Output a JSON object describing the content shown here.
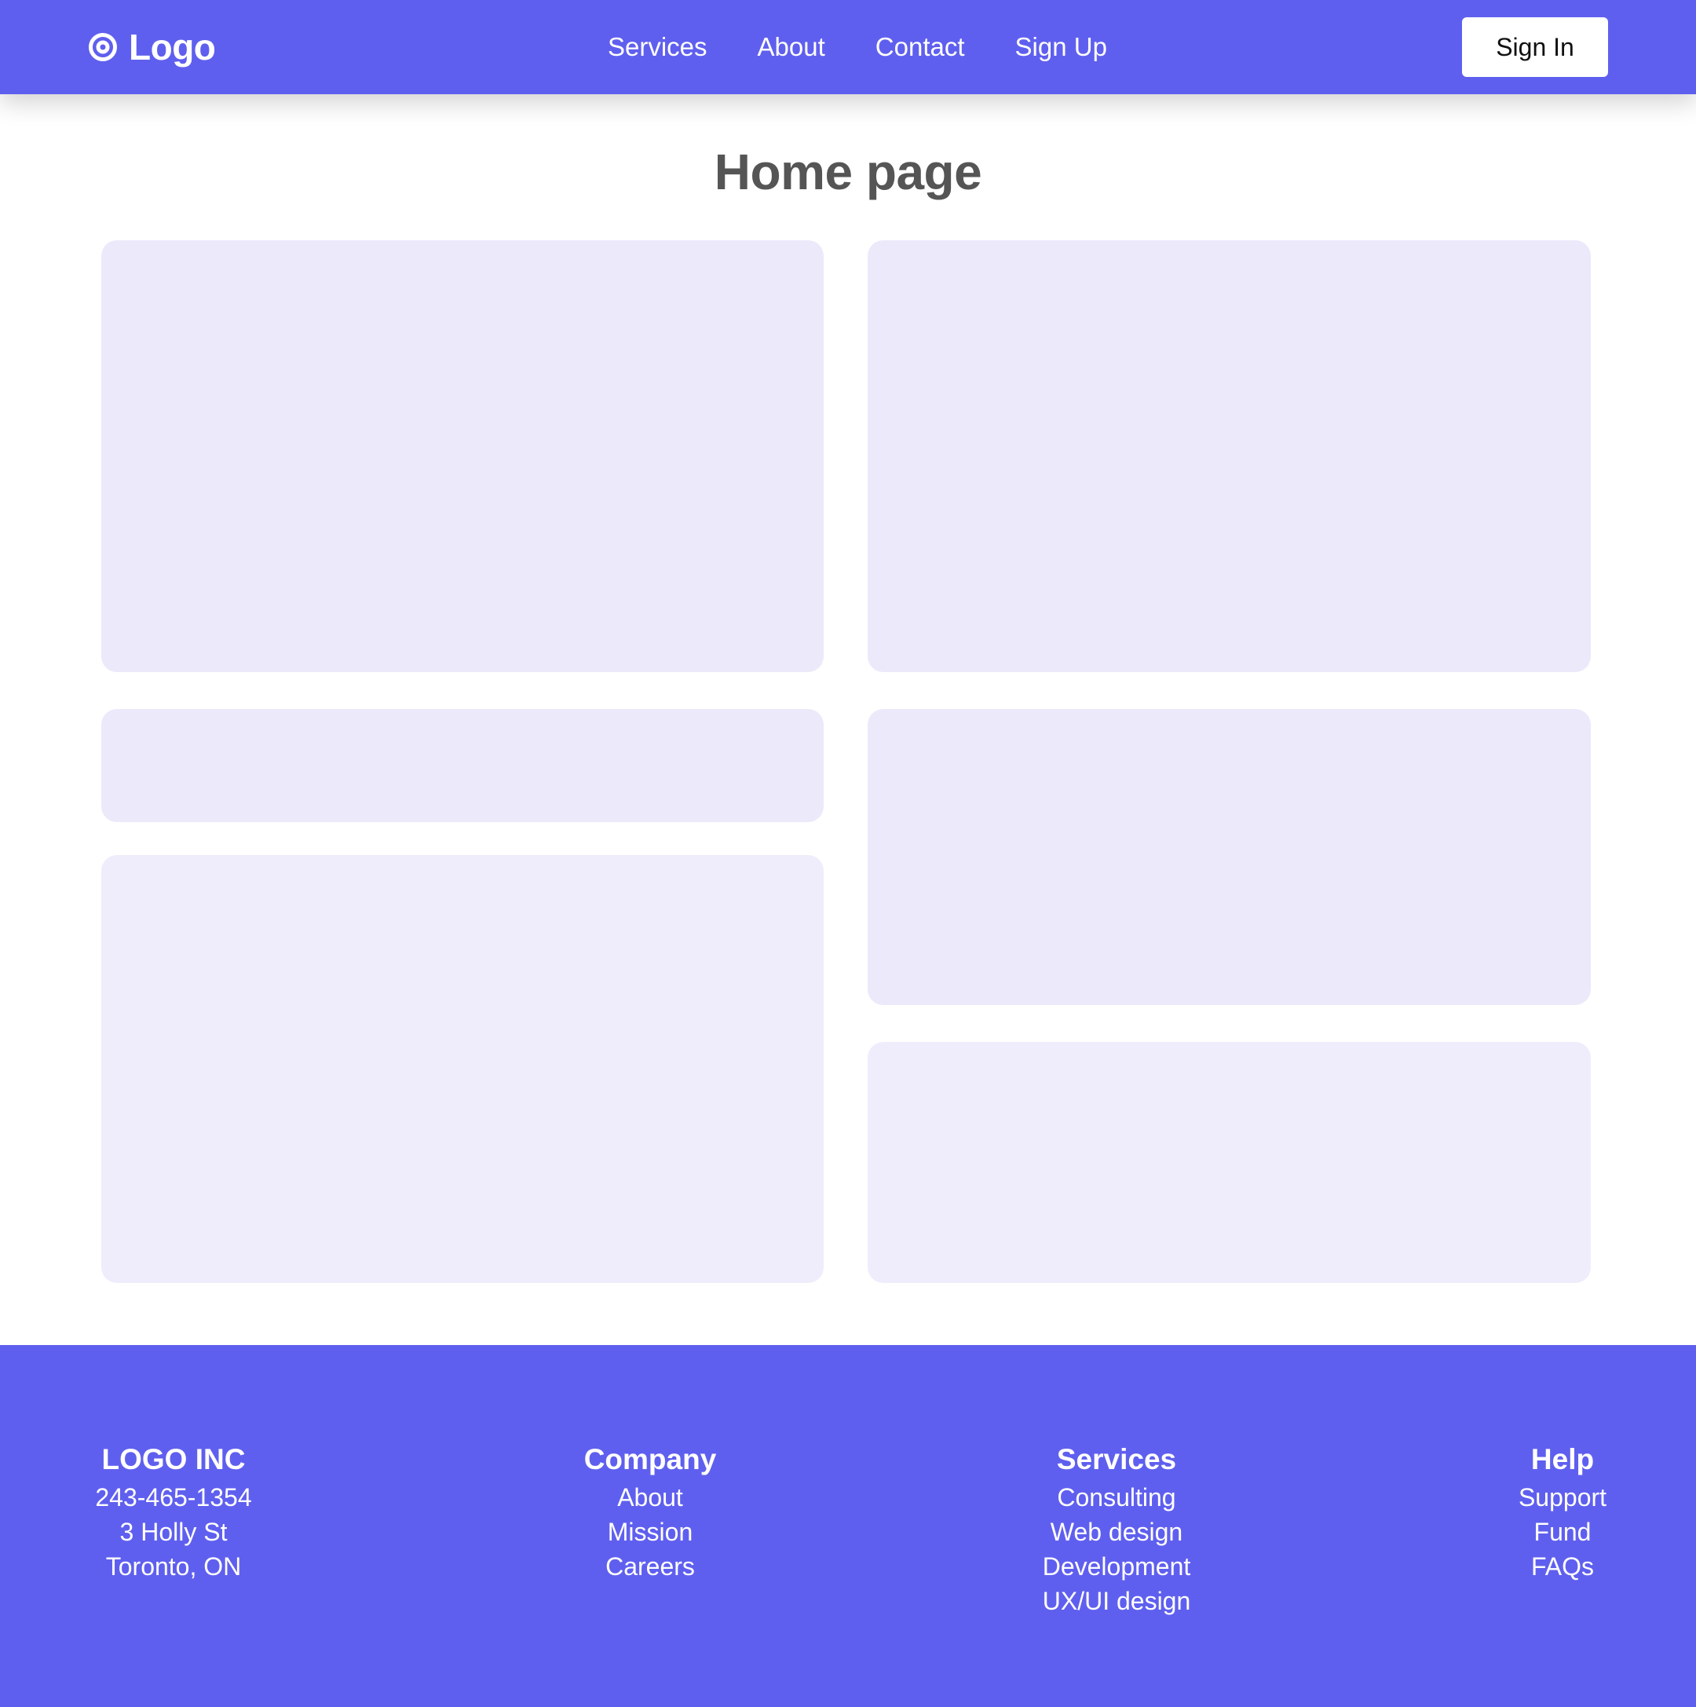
{
  "header": {
    "brand": "Logo",
    "nav": [
      "Services",
      "About",
      "Contact",
      "Sign Up"
    ],
    "signin_label": "Sign In"
  },
  "main": {
    "title": "Home page"
  },
  "footer": {
    "company_block": {
      "title": "LOGO INC",
      "lines": [
        "243-465-1354",
        "3 Holly St",
        "Toronto, ON"
      ]
    },
    "company": {
      "title": "Company",
      "links": [
        "About",
        "Mission",
        "Careers"
      ]
    },
    "services": {
      "title": "Services",
      "links": [
        "Consulting",
        "Web design",
        "Development",
        "UX/UI design"
      ]
    },
    "help": {
      "title": "Help",
      "links": [
        "Support",
        "Fund",
        "FAQs"
      ]
    }
  },
  "colors": {
    "brand": "#5f5fef",
    "card": "#ebe9fa",
    "card_light": "#efedfb",
    "title_text": "#555555"
  },
  "icons": {
    "logo": "target-icon"
  }
}
